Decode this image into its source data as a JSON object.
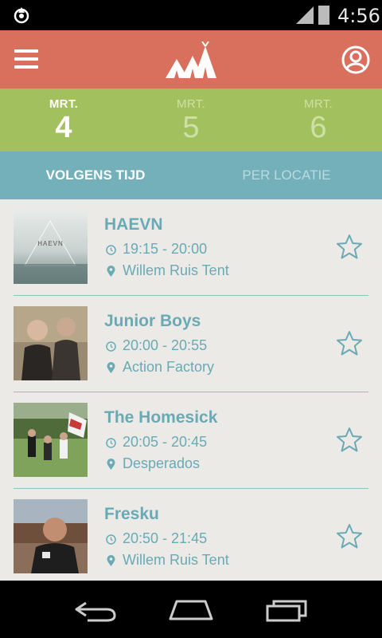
{
  "status_bar": {
    "time": "4:56"
  },
  "header": {
    "menu_icon": "hamburger-menu-icon",
    "logo_icon": "tents-logo-icon",
    "profile_icon": "user-profile-icon"
  },
  "days": [
    {
      "month": "MRT.",
      "day": "4",
      "active": true
    },
    {
      "month": "MRT.",
      "day": "5",
      "active": false
    },
    {
      "month": "MRT.",
      "day": "6",
      "active": false
    }
  ],
  "tabs": [
    {
      "label": "VOLGENS TIJD",
      "active": true
    },
    {
      "label": "PER LOCATIE",
      "active": false
    }
  ],
  "performances": [
    {
      "band": "HAEVN",
      "time": "19:15 - 20:00",
      "location": "Willem Ruis Tent",
      "thumb_text": "HAEVN",
      "starred": false
    },
    {
      "band": "Junior Boys",
      "time": "20:00 - 20:55",
      "location": "Action Factory",
      "starred": false
    },
    {
      "band": "The Homesick",
      "time": "20:05 - 20:45",
      "location": "Desperados",
      "starred": false
    },
    {
      "band": "Fresku",
      "time": "20:50 - 21:45",
      "location": "Willem Ruis Tent",
      "starred": false
    }
  ],
  "colors": {
    "header": "#d9705e",
    "days_bar": "#a3c05e",
    "tabs_bar": "#74b0ba",
    "list_bg": "#ebeae6",
    "accent_text": "#6aaab5"
  }
}
